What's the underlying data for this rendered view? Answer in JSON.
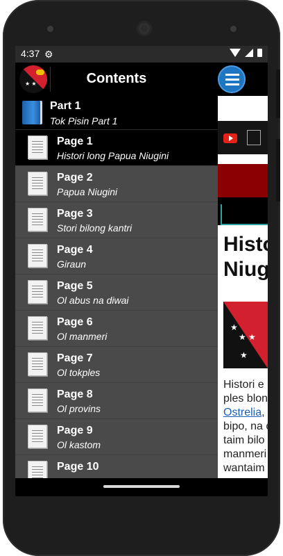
{
  "status_bar": {
    "time": "4:37",
    "icons": [
      "settings-gear",
      "wifi",
      "signal",
      "battery"
    ]
  },
  "drawer": {
    "title": "Contents",
    "part": {
      "title": "Part 1",
      "subtitle": "Tok Pisin Part 1"
    },
    "pages": [
      {
        "title": "Page 1",
        "subtitle": "Histori long Papua Niugini",
        "active": true
      },
      {
        "title": "Page 2",
        "subtitle": "Papua Niugini"
      },
      {
        "title": "Page 3",
        "subtitle": "Stori bilong kantri"
      },
      {
        "title": "Page 4",
        "subtitle": "Giraun"
      },
      {
        "title": "Page 5",
        "subtitle": "Ol abus na diwai"
      },
      {
        "title": "Page 6",
        "subtitle": "Ol manmeri"
      },
      {
        "title": "Page 7",
        "subtitle": "Ol tokples"
      },
      {
        "title": "Page 8",
        "subtitle": "Ol provins"
      },
      {
        "title": "Page 9",
        "subtitle": "Ol kastom"
      },
      {
        "title": "Page 10",
        "subtitle": ""
      }
    ]
  },
  "content": {
    "heading_line1": "Histo",
    "heading_line2": "Niug",
    "text_line1": "Histori e",
    "text_line2": "ples blon",
    "text_link": "Ostrelia",
    "text_line3_rest": ",",
    "text_line4": "bipo, na c",
    "text_line5": "taim bilo",
    "text_line6": "manmeri",
    "text_line7": "wantaim"
  }
}
